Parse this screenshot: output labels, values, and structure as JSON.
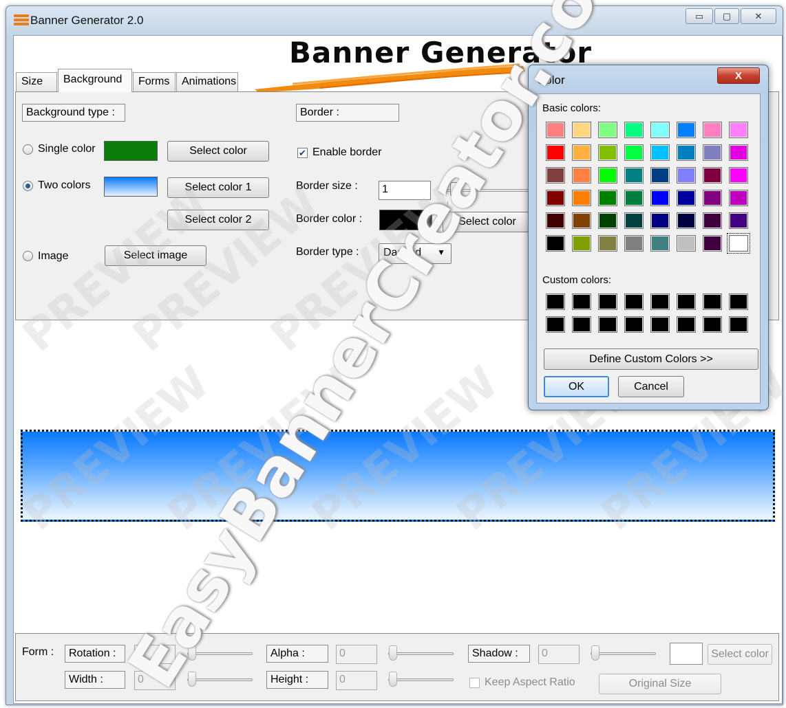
{
  "window": {
    "title": "Banner Generator 2.0",
    "minimize": "▭",
    "maximize": "▢",
    "close": "✕"
  },
  "header": {
    "title": "Banner Generator"
  },
  "tabs": [
    {
      "label": "Size"
    },
    {
      "label": "Background",
      "active": true
    },
    {
      "label": "Forms"
    },
    {
      "label": "Animations"
    }
  ],
  "background": {
    "type_label": "Background type :",
    "single_color": {
      "label": "Single color",
      "color": "#0a7d0a",
      "button": "Select color"
    },
    "two_colors": {
      "label": "Two colors",
      "color_top": "#0a79ff",
      "color_bottom": "#e6f2ff",
      "button1": "Select color 1",
      "button2": "Select color 2"
    },
    "image": {
      "label": "Image",
      "button": "Select image"
    },
    "selected": "two_colors"
  },
  "border": {
    "label": "Border :",
    "enable_label": "Enable border",
    "enabled": true,
    "size_label": "Border size :",
    "size_value": "1",
    "color_label": "Border color :",
    "color": "#000000",
    "color_button": "Select color",
    "type_label": "Border type :",
    "type_value": "Dashed"
  },
  "form": {
    "form_label": "Form :",
    "rotation_label": "Rotation :",
    "rotation_value": "0",
    "alpha_label": "Alpha :",
    "alpha_value": "0",
    "shadow_label": "Shadow :",
    "shadow_value": "0",
    "select_color": "Select color",
    "width_label": "Width :",
    "width_value": "0",
    "height_label": "Height :",
    "height_value": "0",
    "keep_aspect": "Keep Aspect Ratio",
    "original_size": "Original Size"
  },
  "color_dialog": {
    "title": "Color",
    "close": "X",
    "basic_label": "Basic colors:",
    "custom_label": "Custom colors:",
    "define_button": "Define Custom Colors >>",
    "ok": "OK",
    "cancel": "Cancel",
    "basic_colors": [
      "#ff8080",
      "#ffd780",
      "#80ff80",
      "#00ff80",
      "#80ffff",
      "#0080ff",
      "#ff80c0",
      "#ff80ff",
      "#ff0000",
      "#ffb040",
      "#80c000",
      "#00ff40",
      "#00c0ff",
      "#0080c0",
      "#8080c0",
      "#e000e0",
      "#804040",
      "#ff8040",
      "#00ff00",
      "#008080",
      "#004080",
      "#8080ff",
      "#800040",
      "#ff00ff",
      "#800000",
      "#ff8000",
      "#008000",
      "#008040",
      "#0000ff",
      "#0000a0",
      "#800080",
      "#c000c0",
      "#400000",
      "#804000",
      "#004000",
      "#004040",
      "#000080",
      "#000040",
      "#400040",
      "#400080",
      "#000000",
      "#80a000",
      "#808040",
      "#808080",
      "#408080",
      "#c0c0c0",
      "#400040",
      "#ffffff"
    ],
    "selected_index": 47,
    "custom_colors": [
      "#000000",
      "#000000",
      "#000000",
      "#000000",
      "#000000",
      "#000000",
      "#000000",
      "#000000",
      "#000000",
      "#000000",
      "#000000",
      "#000000",
      "#000000",
      "#000000",
      "#000000",
      "#000000"
    ]
  },
  "watermark": {
    "repeat": "PREVIEW",
    "site": "EasyBannerCreator.com"
  }
}
